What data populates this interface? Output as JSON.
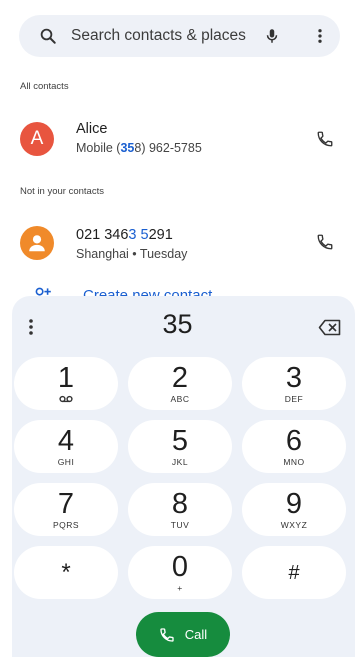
{
  "search": {
    "placeholder": "Search contacts & places"
  },
  "sections": {
    "all_contacts": "All contacts",
    "not_in_contacts": "Not in your contacts"
  },
  "contacts": [
    {
      "avatar_letter": "A",
      "name": "Alice",
      "detail_pre": "Mobile (",
      "detail_match": "35",
      "detail_post": "8) 962-5785"
    }
  ],
  "suggestions": [
    {
      "number_pre": "021 346",
      "number_match": "3 5",
      "number_post": "291",
      "detail": "Shanghai • Tuesday"
    }
  ],
  "create_contact": "Create new contact",
  "dialer": {
    "digits": "35",
    "keys": [
      {
        "num": "1",
        "letters": ""
      },
      {
        "num": "2",
        "letters": "ABC"
      },
      {
        "num": "3",
        "letters": "DEF"
      },
      {
        "num": "4",
        "letters": "GHI"
      },
      {
        "num": "5",
        "letters": "JKL"
      },
      {
        "num": "6",
        "letters": "MNO"
      },
      {
        "num": "7",
        "letters": "PQRS"
      },
      {
        "num": "8",
        "letters": "TUV"
      },
      {
        "num": "9",
        "letters": "WXYZ"
      },
      {
        "num": "*",
        "letters": ""
      },
      {
        "num": "0",
        "letters": "+"
      },
      {
        "num": "#",
        "letters": ""
      }
    ],
    "call_label": "Call"
  },
  "colors": {
    "accent_blue": "#1a5fd0",
    "call_green": "#168c3e",
    "avatar_red": "#e8553f",
    "avatar_orange": "#f08a2a",
    "panel_bg": "#edf1f8"
  }
}
